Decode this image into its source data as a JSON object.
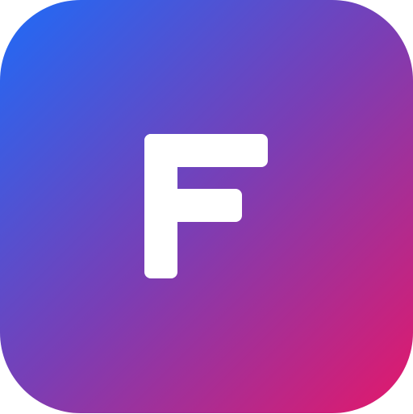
{
  "icon": {
    "name": "app-logo",
    "letter": "F",
    "colors": {
      "gradient_start": "#1E6BF7",
      "gradient_mid": "#7A3EB5",
      "gradient_end": "#E4186A",
      "glyph": "#FFFFFF"
    }
  }
}
